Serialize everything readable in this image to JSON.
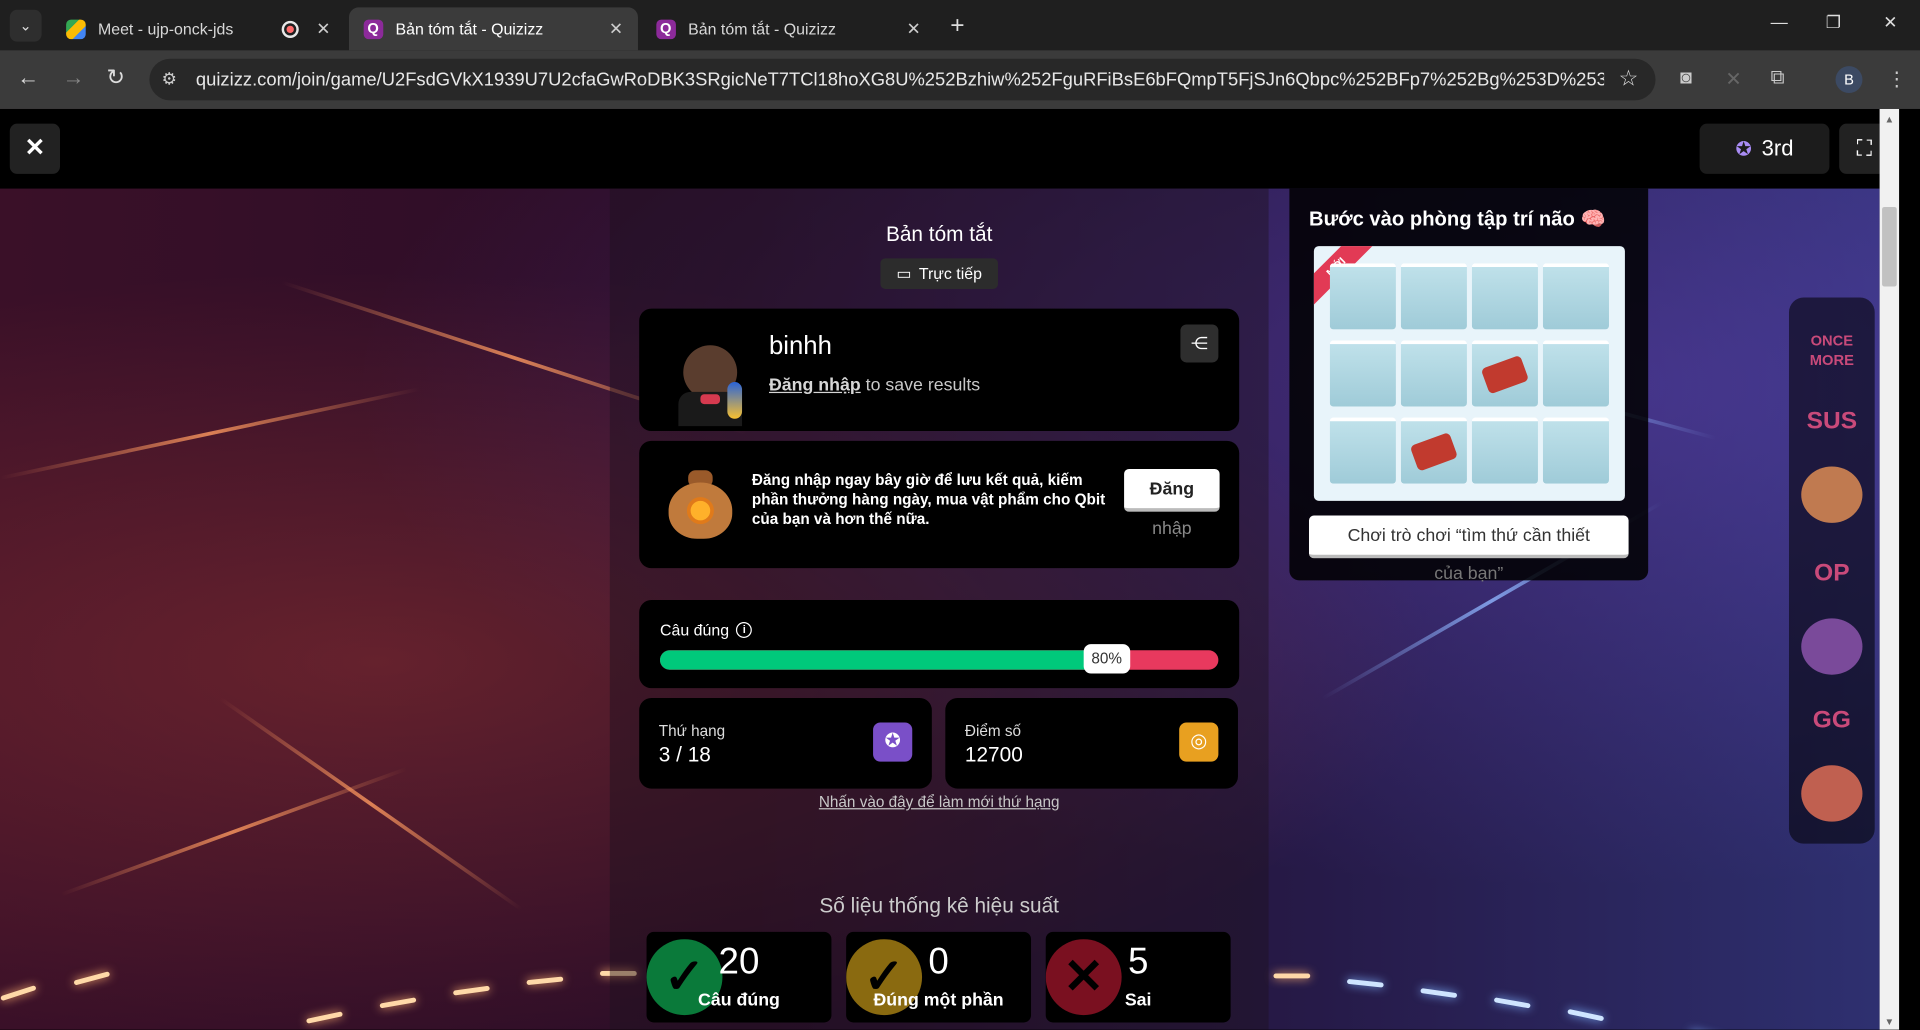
{
  "browser": {
    "tabs": [
      {
        "label": "Meet - ujp-onck-jds",
        "active": false
      },
      {
        "label": "Bản tóm tắt - Quizizz",
        "active": true
      },
      {
        "label": "Bản tóm tắt - Quizizz",
        "active": false
      }
    ],
    "url": "quizizz.com/join/game/U2FsdGVkX1939U7U2cfaGwRoDBK3SRgicNeT7TCl18hoXG8U%252Bzhiw%252FguRFiBsE6bFQmpT5FjSJn6Qbpc%252BFp7%252Bg%253D%253D?gameType=li...",
    "profile_initial": "B"
  },
  "topbar": {
    "rank_label": "3rd"
  },
  "summary": {
    "title": "Bản tóm tắt",
    "live_label": "Trực tiếp"
  },
  "player": {
    "name": "binhh",
    "login_link": "Đăng nhập",
    "login_suffix": "to save results"
  },
  "promo": {
    "text": "Đăng nhập ngay bây giờ để lưu kết quả, kiếm phần thưởng hàng ngày, mua vật phẩm cho Qbit của bạn và hơn thế nữa.",
    "button_label": "Đăng",
    "button_label_overflow": "nhập"
  },
  "accuracy": {
    "label": "Câu đúng",
    "percent_label": "80%",
    "fraction": 0.8
  },
  "stats": {
    "rank_label": "Thứ hạng",
    "rank_value": "3 / 18",
    "score_label": "Điểm số",
    "score_value": "12700",
    "refresh_link": "Nhấn vào đây để làm mới thứ hạng"
  },
  "performance": {
    "title": "Số liệu thống kê hiệu suất",
    "items": [
      {
        "value": "20",
        "label": "Câu đúng",
        "color": "#0a7a3a"
      },
      {
        "value": "0",
        "label": "Đúng một phần",
        "color": "#8a6a10"
      },
      {
        "value": "5",
        "label": "Sai",
        "color": "#7a1020"
      }
    ]
  },
  "brain": {
    "title": "Bước vào phòng tập trí não 🧠",
    "ribbon": "MỚI",
    "play_label": "Chơi trò chơi “tìm thứ cần thiết",
    "play_label_overflow": "của bạn”"
  },
  "stickers": [
    "ONCE MORE",
    "SUS",
    "",
    "OP",
    "",
    "GG",
    ""
  ],
  "colors": {
    "correct": "#00c97b",
    "wrong": "#e8395e",
    "medal": "#7a4fc8",
    "coins": "#e8a020"
  }
}
